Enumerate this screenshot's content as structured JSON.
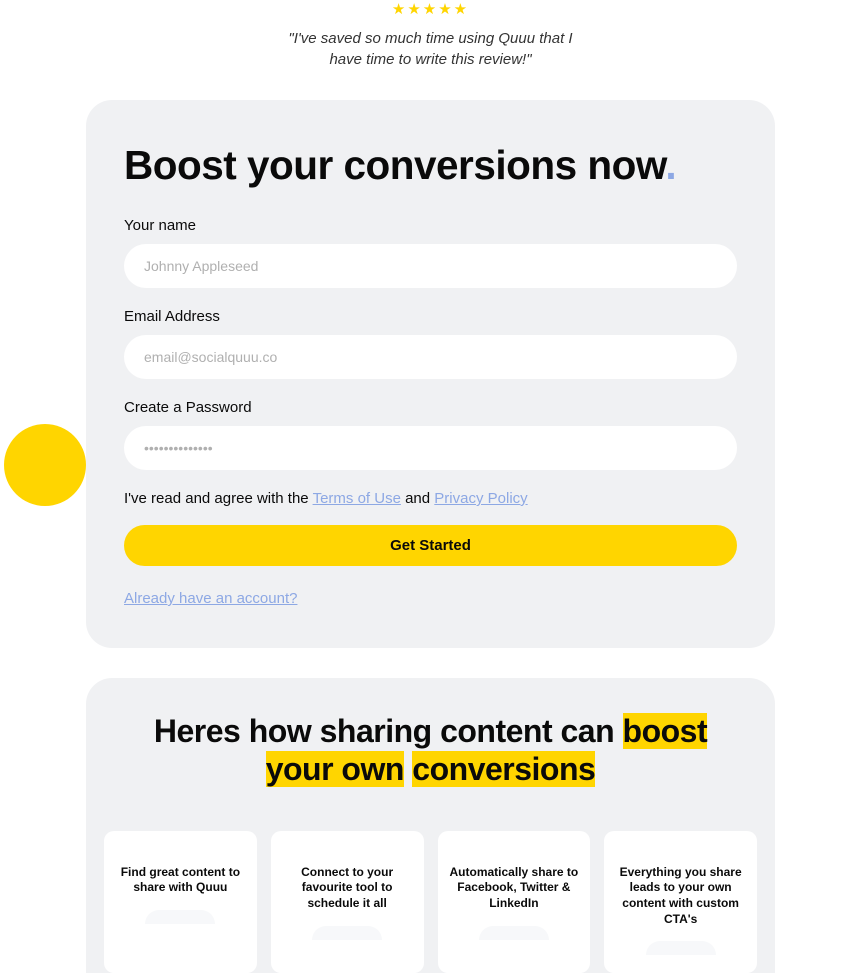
{
  "testimonial": {
    "stars": "★★★★★",
    "quote": "\"I've saved so much time using Quuu that I have time to write this review!\""
  },
  "signup": {
    "title_main": "Boost your conversions now",
    "title_dot": ".",
    "name_label": "Your name",
    "name_placeholder": "Johnny Appleseed",
    "email_label": "Email Address",
    "email_placeholder": "email@socialquuu.co",
    "password_label": "Create a Password",
    "password_placeholder": "••••••••••••••",
    "terms_prefix": "I've read and agree with the ",
    "terms_link": "Terms of Use",
    "terms_mid": " and ",
    "privacy_link": "Privacy Policy",
    "button_label": "Get Started",
    "signin_link": "Already have an account?"
  },
  "features": {
    "title_prefix": "Heres how sharing content can ",
    "title_highlight1": "boost your own",
    "title_break": " ",
    "title_highlight2": "conversions",
    "cards": [
      {
        "text": "Find great content to share with Quuu"
      },
      {
        "text": "Connect to your favourite tool to schedule it all"
      },
      {
        "text": "Automatically share to Facebook, Twitter & LinkedIn"
      },
      {
        "text": "Everything you share leads to your own content with custom CTA's"
      }
    ]
  },
  "colors": {
    "accent_yellow": "#ffd500",
    "link_blue": "#8da8e4",
    "card_bg": "#f0f1f3"
  }
}
